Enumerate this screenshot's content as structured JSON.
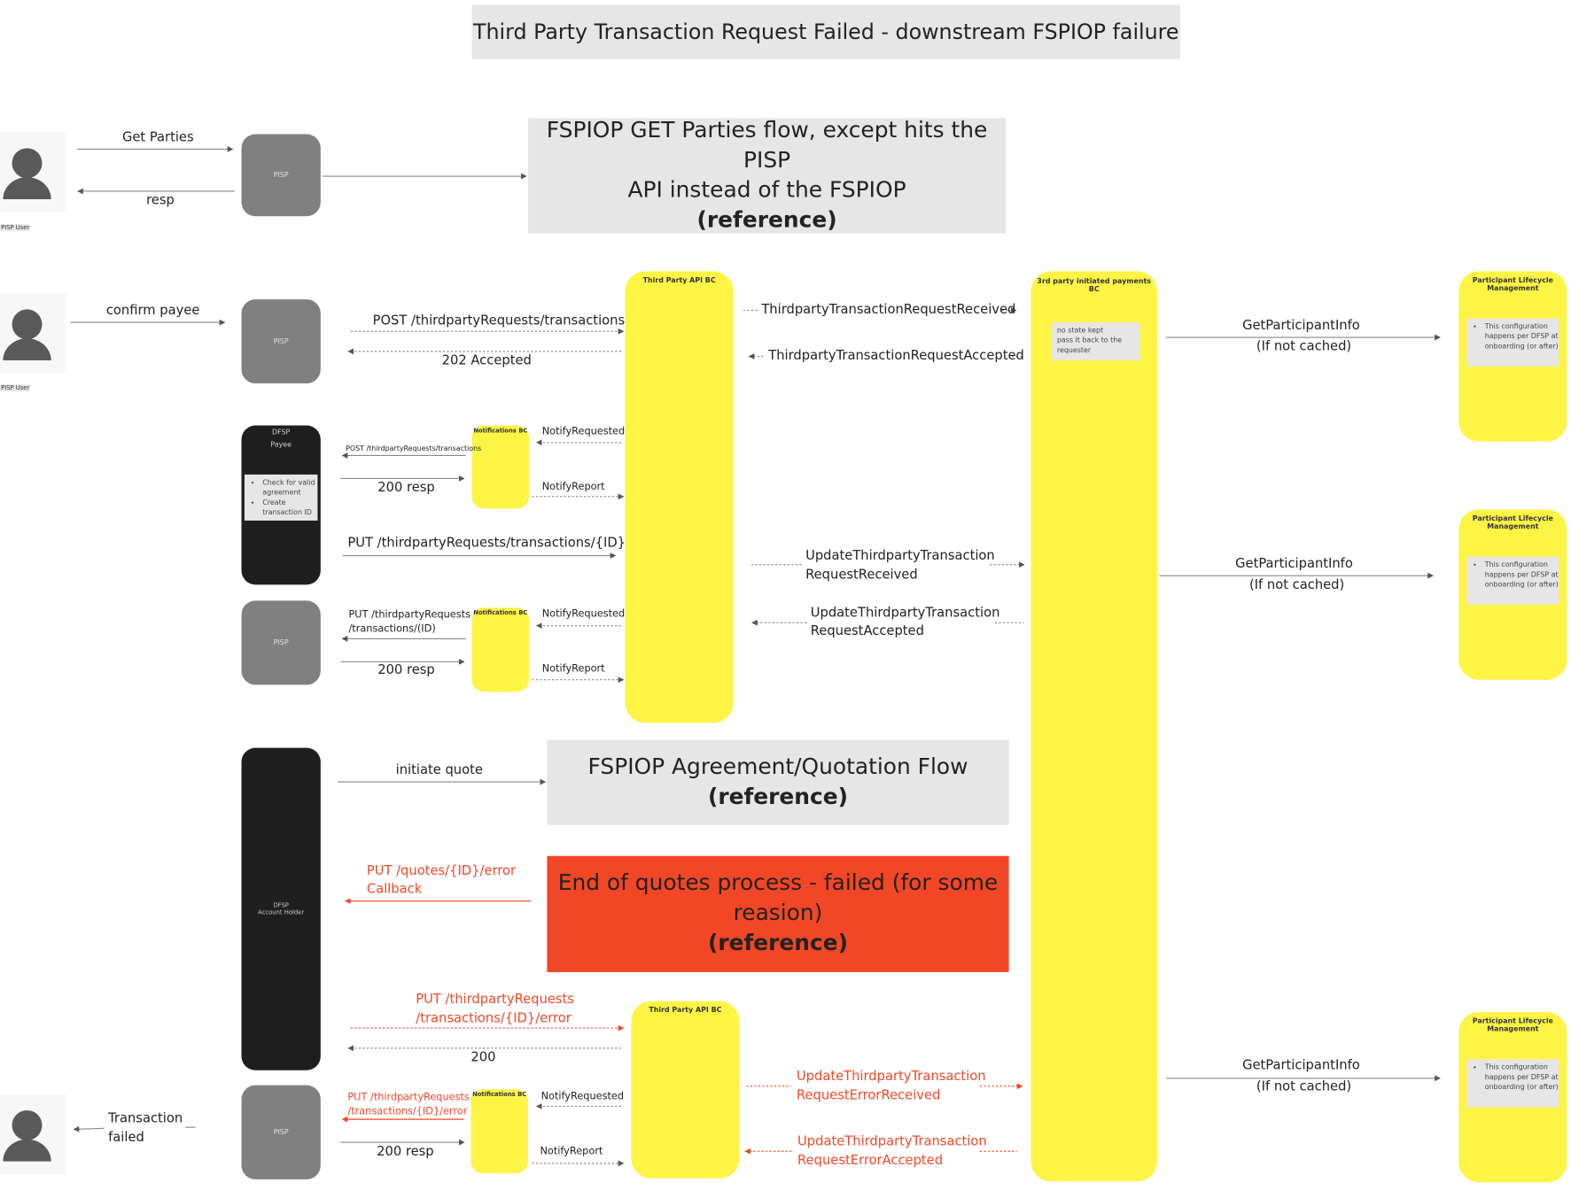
{
  "title": "Third Party Transaction Request Failed - downstream FSPIOP failure",
  "references": {
    "get_parties": {
      "line1": "FSPIOP GET Parties flow, except hits the PISP",
      "line2": "API instead of the FSPIOP",
      "tag": "(reference)"
    },
    "quotation": {
      "line1": "FSPIOP Agreement/Quotation Flow",
      "tag": "(reference)"
    },
    "quotes_failed": {
      "line1": "End of quotes process - failed (for some",
      "line2": "reasion)",
      "tag": "(reference)"
    }
  },
  "actors": {
    "pisp_user": "PISP User",
    "pisp": "PISP",
    "dfsp_payee": {
      "line1": "DFSP",
      "line2": "Payee",
      "notes": [
        "Check for valid agreement",
        "Create transaction ID"
      ]
    },
    "dfsp_account_holder": {
      "line1": "DFSP",
      "line2": "Account Holder"
    },
    "third_party_api_bc": "Third Party API BC",
    "notifications_bc": "Notifications BC",
    "third_party_payments_bc": {
      "title": "3rd party initiated payments BC",
      "note": [
        "no state kept",
        "pass it back to the",
        "requester"
      ]
    },
    "participant_lifecycle": {
      "title": "Participant Lifecycle Management",
      "note": "This configuration happens per DFSP at onboarding (or after)"
    }
  },
  "messages": {
    "get_parties": "Get Parties",
    "resp": "resp",
    "confirm_payee": "confirm payee",
    "post_tpr": "POST /thirdpartyRequests/transactions",
    "accepted_202": "202 Accepted",
    "tpr_received": "ThirdpartyTransactionRequestReceived",
    "tpr_accepted": "ThirdpartyTransactionRequestAccepted",
    "get_participant_info": "GetParticipantInfo",
    "if_not_cached": "(If not cached)",
    "notify_requested": "NotifyRequested",
    "notify_report": "NotifyReport",
    "post_tpr_small": "POST /thirdpartyRequests/transactions",
    "resp_200": "200 resp",
    "put_tpr_id": "PUT /thirdpartyRequests/transactions/{ID}",
    "put_tpr_id_2l": {
      "line1": "PUT /thirdpartyRequests",
      "line2": "/transactions/(ID)"
    },
    "update_received": {
      "line1": "UpdateThirdpartyTransaction",
      "line2": "RequestReceived"
    },
    "update_accepted": {
      "line1": "UpdateThirdpartyTransaction",
      "line2": "RequestAccepted"
    },
    "initiate_quote": "initiate quote",
    "put_quotes_error": {
      "line1": "PUT /quotes/{ID}/error",
      "line2": "Callback"
    },
    "put_tpr_error": {
      "line1": "PUT /thirdpartyRequests",
      "line2": "/transactions/{ID}/error"
    },
    "status_200": "200",
    "put_tpr_error_small": {
      "line1": "PUT /thirdpartyRequests",
      "line2": "/transactions/{ID}/error"
    },
    "update_error_received": {
      "line1": "UpdateThirdpartyTransaction",
      "line2": "RequestErrorReceived"
    },
    "update_error_accepted": {
      "line1": "UpdateThirdpartyTransaction",
      "line2": "RequestErrorAccepted"
    },
    "transaction_failed": {
      "line1": "Transaction",
      "line2": "failed"
    }
  },
  "colors": {
    "yellow": "#fef445",
    "error_red": "#f24726",
    "reference_gray": "#e6e6e6",
    "pisp_gray": "#808080",
    "dfsp_black": "#1e1e1e"
  }
}
